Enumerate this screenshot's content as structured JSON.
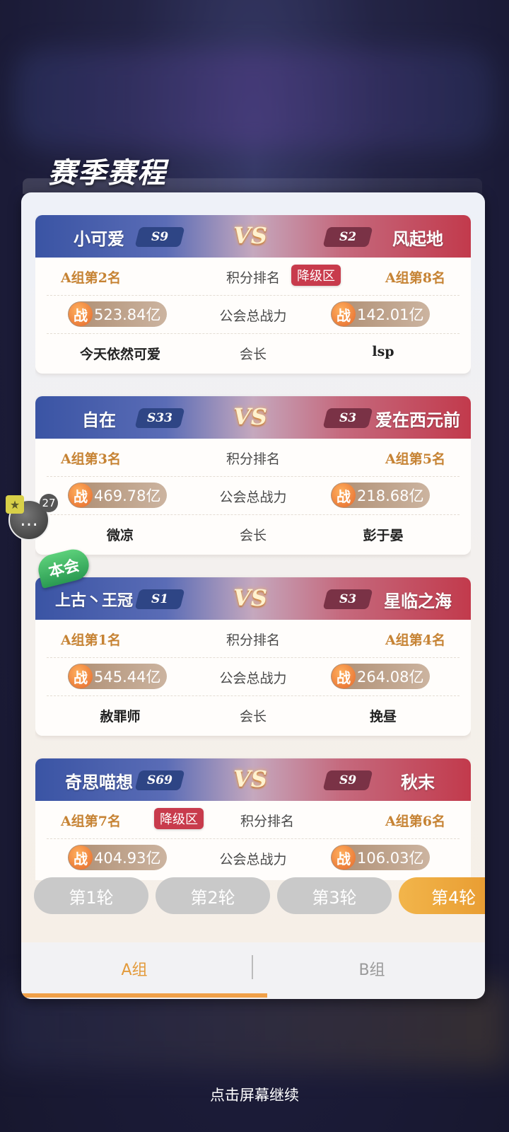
{
  "header": {
    "title": "赛季赛程"
  },
  "labels": {
    "rank_label": "积分排名",
    "power_label": "公会总战力",
    "leader_label": "会长",
    "vs": "VS",
    "zhan": "战",
    "relegation": "降级区",
    "own_guild_badge": "本会"
  },
  "matches": [
    {
      "left": {
        "name": "小可爱",
        "season": "S9",
        "rank": "A组第2名",
        "power": "523.84亿",
        "leader": "今天依然可爱"
      },
      "right": {
        "name": "风起地",
        "season": "S2",
        "rank": "A组第8名",
        "power": "142.01亿",
        "leader": "lsp"
      }
    },
    {
      "left": {
        "name": "自在",
        "season": "S33",
        "rank": "A组第3名",
        "power": "469.78亿",
        "leader": "微凉"
      },
      "right": {
        "name": "爱在西元前",
        "season": "S3",
        "rank": "A组第5名",
        "power": "218.68亿",
        "leader": "彭于晏"
      }
    },
    {
      "left": {
        "name": "上古丶王冠",
        "season": "S1",
        "rank": "A组第1名",
        "power": "545.44亿",
        "leader": "赦罪师"
      },
      "right": {
        "name": "星临之海",
        "season": "S3",
        "rank": "A组第4名",
        "power": "264.08亿",
        "leader": "挽昼"
      }
    },
    {
      "left": {
        "name": "奇思喵想",
        "season": "S69",
        "rank": "A组第7名",
        "power": "404.93亿"
      },
      "right": {
        "name": "秋末",
        "season": "S9",
        "rank": "A组第6名",
        "power": "106.03亿"
      }
    }
  ],
  "rounds": [
    "第1轮",
    "第2轮",
    "第3轮",
    "第4轮"
  ],
  "active_round": "第4轮",
  "groups": {
    "a": "A组",
    "b": "B组",
    "active": "A组"
  },
  "chat": {
    "count": "27"
  },
  "footer": {
    "hint": "点击屏幕继续"
  },
  "colors": {
    "accent": "#f0a048",
    "relegation": "#c83b4c",
    "left_team": "#3a54a4",
    "right_team": "#c23a4c"
  }
}
